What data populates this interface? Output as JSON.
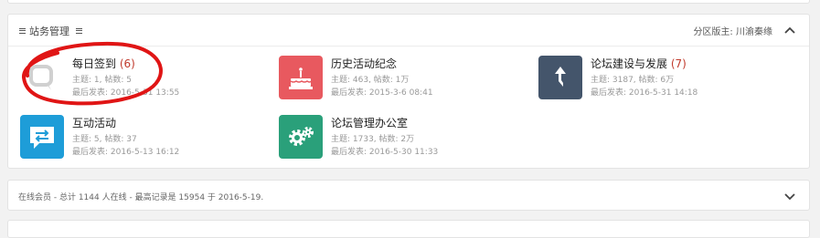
{
  "section": {
    "title": "站务管理",
    "moderator_label": "分区版主:",
    "moderator_name": "川渝秦缘"
  },
  "forums": [
    {
      "name": "每日签到",
      "today": "(6)",
      "stats": "主题: 1, 帖数: 5",
      "last": "最后发表: 2016-5-31 13:55",
      "icon": "speech-bubble-icon",
      "color": "#d0d0d0"
    },
    {
      "name": "历史活动纪念",
      "today": "",
      "stats": "主题: 463, 帖数: 1万",
      "last": "最后发表: 2015-3-6 08:41",
      "icon": "cake-icon",
      "color": "#e8595f"
    },
    {
      "name": "论坛建设与发展",
      "today": "(7)",
      "stats": "主题: 3187, 帖数: 6万",
      "last": "最后发表: 2016-5-31 14:18",
      "icon": "arrow-up-icon",
      "color": "#44556b"
    },
    {
      "name": "互动活动",
      "today": "",
      "stats": "主题: 5, 帖数: 37",
      "last": "最后发表: 2016-5-13 16:12",
      "icon": "exchange-icon",
      "color": "#1e9dd8"
    },
    {
      "name": "论坛管理办公室",
      "today": "",
      "stats": "主题: 1733, 帖数: 2万",
      "last": "最后发表: 2016-5-30 11:33",
      "icon": "gears-icon",
      "color": "#2aa07a"
    }
  ],
  "online": {
    "text": "在线会员 - 总计 1144 人在线 - 最高记录是 15954 于 2016-5-19."
  }
}
